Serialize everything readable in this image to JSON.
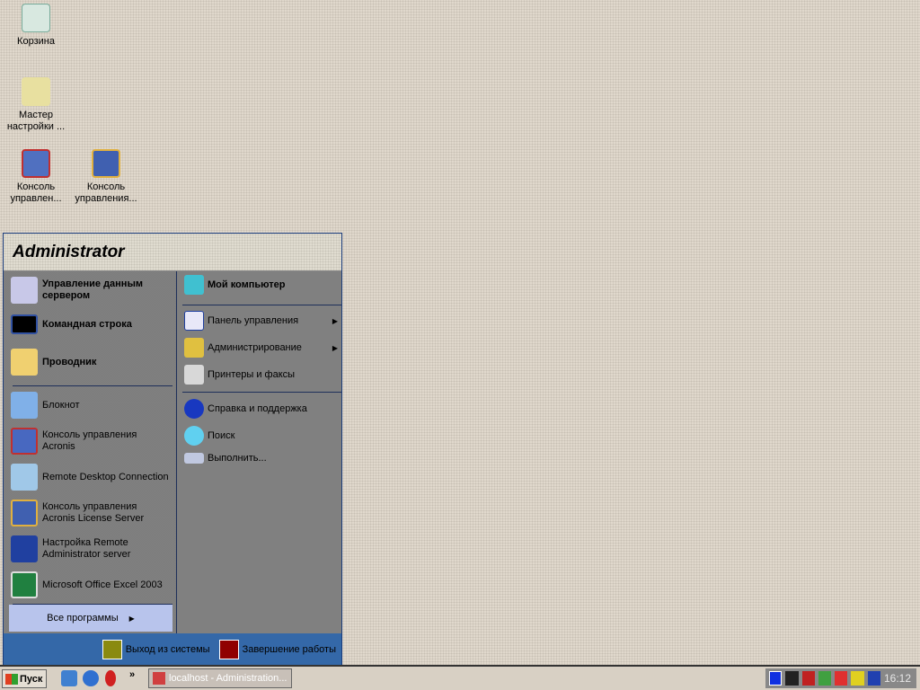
{
  "desktop": {
    "icons": [
      {
        "label": "Корзина"
      },
      {
        "label": "Мастер настройки ..."
      },
      {
        "label": "Консоль управлен..."
      },
      {
        "label": "Консоль управления..."
      }
    ]
  },
  "start_menu": {
    "user": "Administrator",
    "pinned": [
      {
        "label": "Управление данным сервером",
        "icon": "server-icon"
      },
      {
        "label": "Командная строка",
        "icon": "cmd-icon"
      },
      {
        "label": "Проводник",
        "icon": "explorer-icon"
      }
    ],
    "recent": [
      {
        "label": "Блокнот",
        "icon": "notepad-icon"
      },
      {
        "label": "Консоль управления Acronis",
        "icon": "acronis-icon"
      },
      {
        "label": "Remote Desktop Connection",
        "icon": "rdp-icon"
      },
      {
        "label": "Консоль управления Acronis License Server",
        "icon": "acronis-license-icon"
      },
      {
        "label": "Настройка Remote Administrator server",
        "icon": "radmin-icon"
      },
      {
        "label": "Microsoft Office Excel 2003",
        "icon": "excel-icon"
      }
    ],
    "all_programs": "Все программы",
    "right": [
      {
        "label": "Мой компьютер"
      },
      {
        "label": "Панель управления"
      },
      {
        "label": "Администрирование"
      },
      {
        "label": "Принтеры и факсы"
      },
      {
        "label": "Справка и поддержка"
      },
      {
        "label": "Поиск"
      },
      {
        "label": "Выполнить..."
      }
    ],
    "logoff": "Выход из системы",
    "shutdown": "Завершение работы"
  },
  "taskbar": {
    "start": "Пуск",
    "more": "»",
    "task": "localhost - Administration...",
    "clock": "16:12"
  }
}
